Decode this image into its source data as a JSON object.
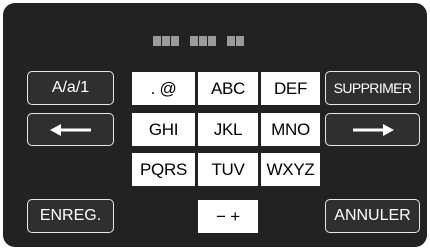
{
  "text_field": {
    "pattern": [
      1,
      1,
      1,
      0,
      1,
      1,
      1,
      0,
      1,
      1
    ]
  },
  "keys": {
    "mode": "A/a/1",
    "symbols": ". @",
    "abc": "ABC",
    "def": "DEF",
    "delete": "SUPPRIMER",
    "ghi": "GHI",
    "jkl": "JKL",
    "mno": "MNO",
    "pqrs": "PQRS",
    "tuv": "TUV",
    "wxyz": "WXYZ",
    "save": "ENREG.",
    "minus_plus": "− +",
    "cancel": "ANNULER"
  },
  "icons": {
    "cursor_left": "arrow-left-icon",
    "cursor_right": "arrow-right-icon"
  }
}
